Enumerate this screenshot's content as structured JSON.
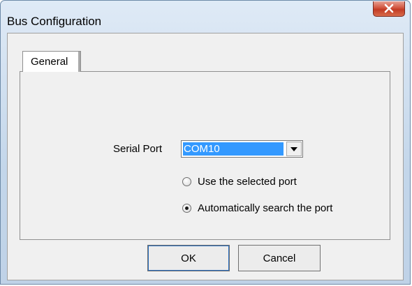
{
  "window": {
    "title": "Bus Configuration"
  },
  "tabs": [
    {
      "label": "General"
    }
  ],
  "serial_port": {
    "label": "Serial Port",
    "selected_value": "COM10"
  },
  "port_mode": {
    "options": [
      {
        "label": "Use the selected port",
        "selected": false
      },
      {
        "label": "Automatically search the port",
        "selected": true
      }
    ]
  },
  "buttons": {
    "ok_label": "OK",
    "cancel_label": "Cancel"
  },
  "icons": {
    "close": "close-icon",
    "dropdown": "chevron-down-icon"
  },
  "colors": {
    "selection": "#3399ff",
    "close_button": "#c8432c"
  }
}
